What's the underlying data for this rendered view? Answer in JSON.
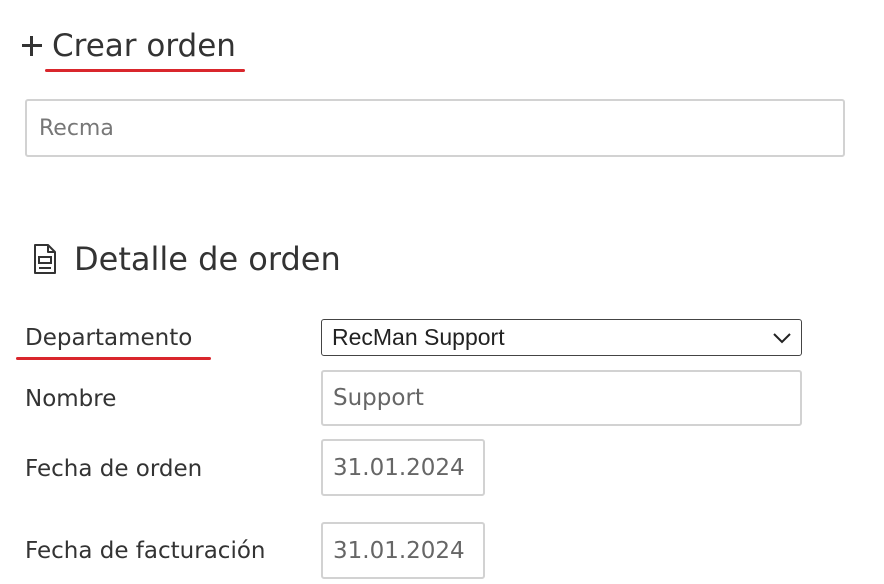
{
  "header": {
    "title": "Crear orden",
    "accent_color": "#d9262c"
  },
  "order_name_input": {
    "value": "Recma"
  },
  "detail_section": {
    "title": "Detalle de orden",
    "icon": "document-icon"
  },
  "fields": {
    "department": {
      "label": "Departamento",
      "value": "RecMan Support"
    },
    "name": {
      "label": "Nombre",
      "value": "Support"
    },
    "order_date": {
      "label": "Fecha de orden",
      "value": "31.01.2024"
    },
    "billing_date": {
      "label": "Fecha de facturación",
      "value": "31.01.2024"
    }
  }
}
